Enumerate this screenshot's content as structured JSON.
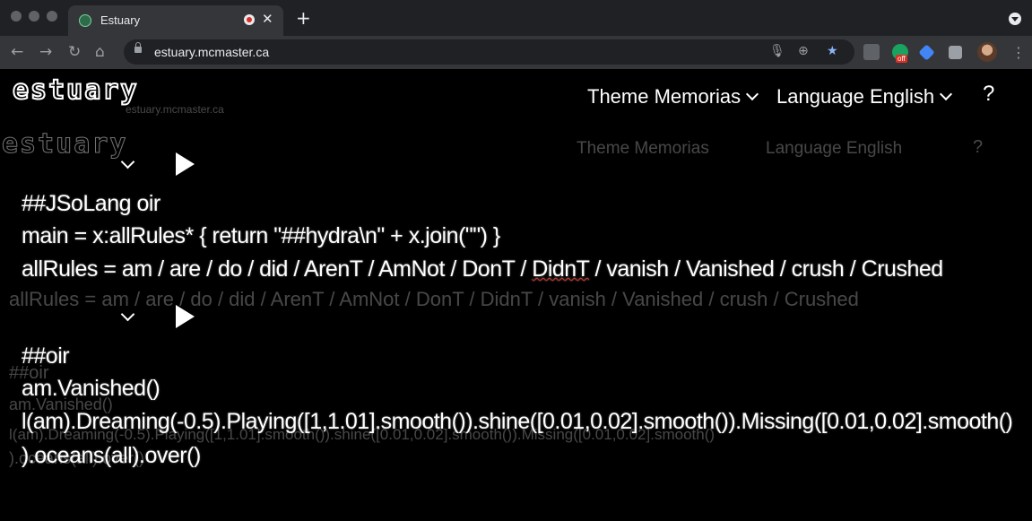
{
  "browser": {
    "tab_title": "Estuary",
    "url": "estuary.mcmaster.ca",
    "ext_off_badge": "off"
  },
  "app": {
    "logo_text": "estuary",
    "theme_label": "Theme Memorias",
    "language_label": "Language English",
    "help_label": "?"
  },
  "ghost": {
    "subtitle": "estuary.mcmaster.ca",
    "theme_label": "Theme Memorias",
    "language_label": "Language English",
    "help_label": "?",
    "rules_line": "allRules = am / are / do / did / ArenT / AmNot / DonT / DidnT / vanish / Vanished / crush / Crushed",
    "oir_header": "##oir",
    "vanished_line": "am.Vanished()",
    "long_line": "l(am).Dreaming(-0.5).Playing([1,1.01].smooth()).shine([0.01,0.02].smooth()).Missing([0.01,0.02].smooth()",
    "oceans_line": ").oceans(all).over()"
  },
  "editor1": {
    "line1": "##JSoLang oir",
    "line2": "main = x:allRules* { return \"##hydra\\n\" + x.join(\"\") }",
    "line3_prefix": "allRules = am / are / do / did / ArenT / AmNot / DonT / ",
    "line3_flagged": "DidnT",
    "line3_suffix": " / vanish / Vanished / crush / Crushed"
  },
  "editor2": {
    "line1": "##oir",
    "line2": "am.Vanished()",
    "line3": "l(am).Dreaming(-0.5).Playing([1,1.01].smooth()).shine([0.01,0.02].smooth()).Missing([0.01,0.02].smooth()",
    "line4": ").oceans(all).over()"
  }
}
